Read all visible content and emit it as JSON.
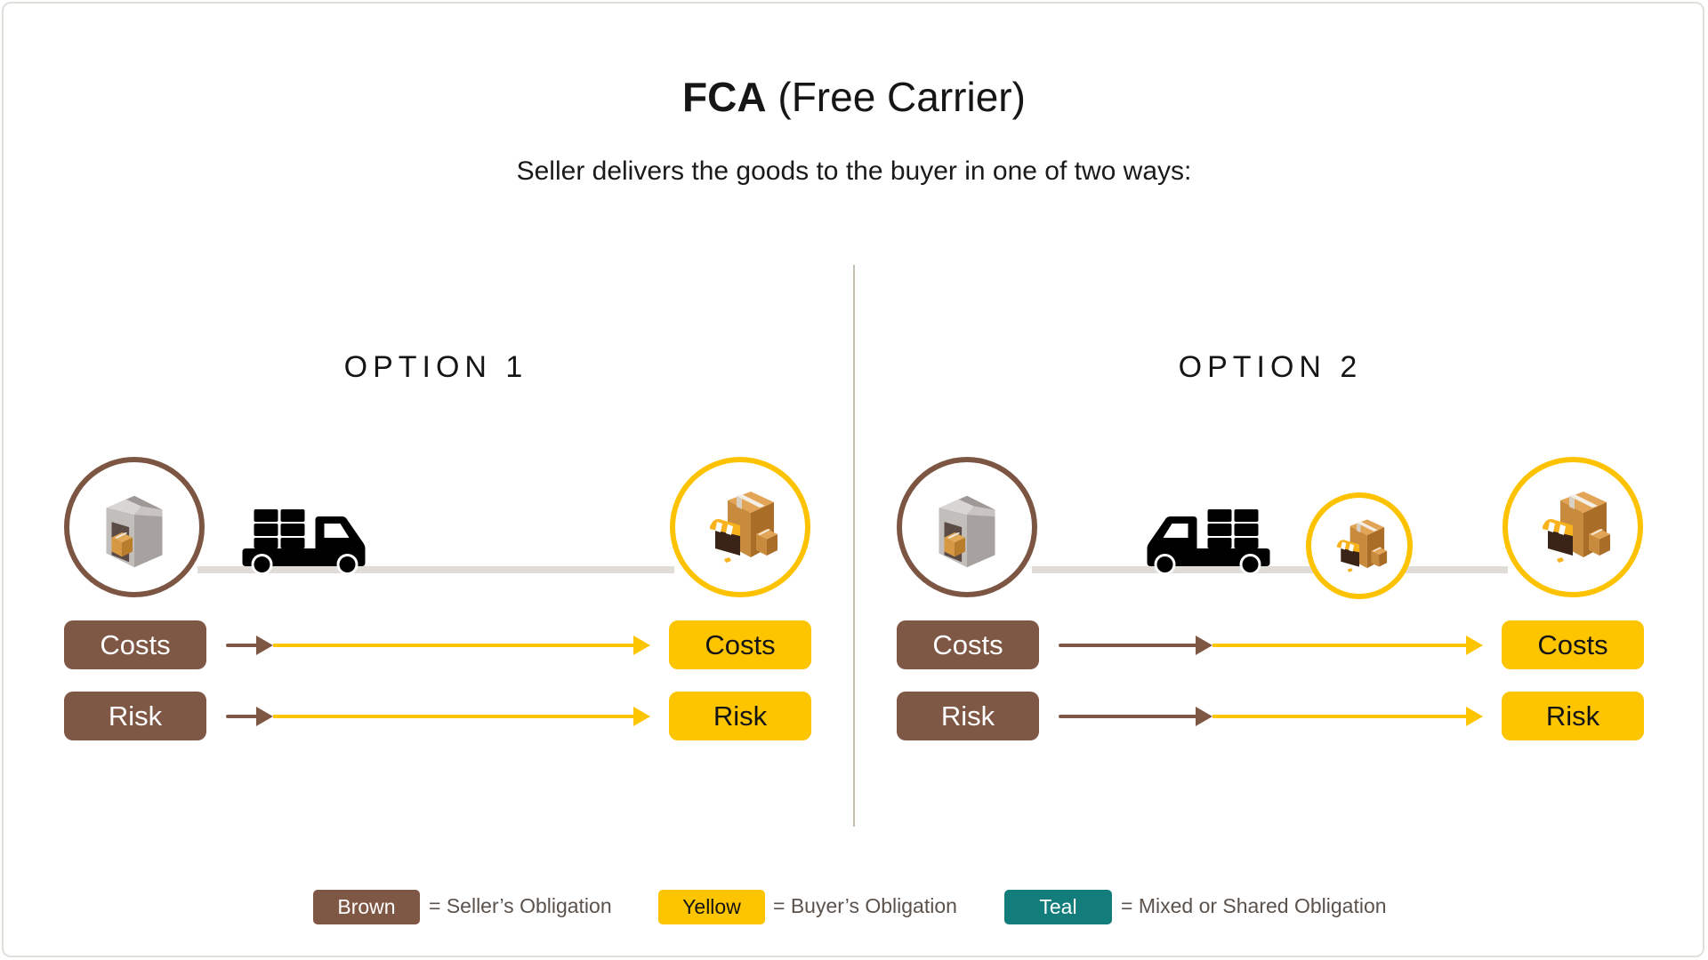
{
  "header": {
    "title_bold": "FCA",
    "title_rest": " (Free Carrier)",
    "subtitle": "Seller delivers the goods to the buyer in one of two ways:"
  },
  "colors": {
    "brown": "#7e5845",
    "yellow": "#fdc400",
    "teal": "#127d7a",
    "track": "#e0dcd7",
    "divider": "#c5bcb2"
  },
  "options": [
    {
      "title": "OPTION 1",
      "start_icon": "warehouse-icon",
      "vehicle_icon": "truck-icon",
      "vehicle_color": "yellow",
      "end_icon": "store-packages-icon",
      "rows": [
        {
          "seller_label": "Costs",
          "buyer_label": "Costs",
          "transfer": "immediate"
        },
        {
          "seller_label": "Risk",
          "buyer_label": "Risk",
          "transfer": "immediate"
        }
      ]
    },
    {
      "title": "OPTION 2",
      "start_icon": "warehouse-icon",
      "vehicle_icon": "truck-icon",
      "vehicle_color": "brown",
      "mid_icon": "store-packages-icon",
      "end_icon": "store-packages-icon",
      "rows": [
        {
          "seller_label": "Costs",
          "buyer_label": "Costs",
          "transfer": "midway"
        },
        {
          "seller_label": "Risk",
          "buyer_label": "Risk",
          "transfer": "midway"
        }
      ]
    }
  ],
  "legend": [
    {
      "label": "Brown",
      "description": "= Seller’s Obligation",
      "color": "#7e5845"
    },
    {
      "label": "Yellow",
      "description": "= Buyer’s Obligation",
      "color": "#fdc400"
    },
    {
      "label": "Teal",
      "description": "= Mixed or Shared Obligation",
      "color": "#127d7a"
    }
  ]
}
